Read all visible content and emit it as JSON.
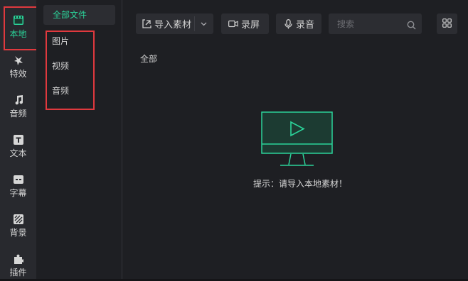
{
  "sidebar": {
    "items": [
      {
        "label": "本地",
        "icon": "film-icon",
        "active": true
      },
      {
        "label": "特效",
        "icon": "magic-icon"
      },
      {
        "label": "音频",
        "icon": "music-note-icon"
      },
      {
        "label": "文本",
        "icon": "text-icon"
      },
      {
        "label": "字幕",
        "icon": "caption-icon"
      },
      {
        "label": "背景",
        "icon": "background-icon"
      },
      {
        "label": "插件",
        "icon": "puzzle-icon"
      }
    ]
  },
  "categories": {
    "all": "全部文件",
    "items": [
      {
        "label": "图片"
      },
      {
        "label": "视频"
      },
      {
        "label": "音频"
      }
    ]
  },
  "toolbar": {
    "import_label": "导入素材",
    "record_screen_label": "录屏",
    "record_audio_label": "录音",
    "search_placeholder": "搜索"
  },
  "main": {
    "section_label": "全部",
    "empty_hint": "提示：请导入本地素材！"
  },
  "colors": {
    "accent": "#2bd49a",
    "highlight_box": "#e0393e",
    "background": "#1e1f23",
    "panel": "#2c2d32"
  }
}
